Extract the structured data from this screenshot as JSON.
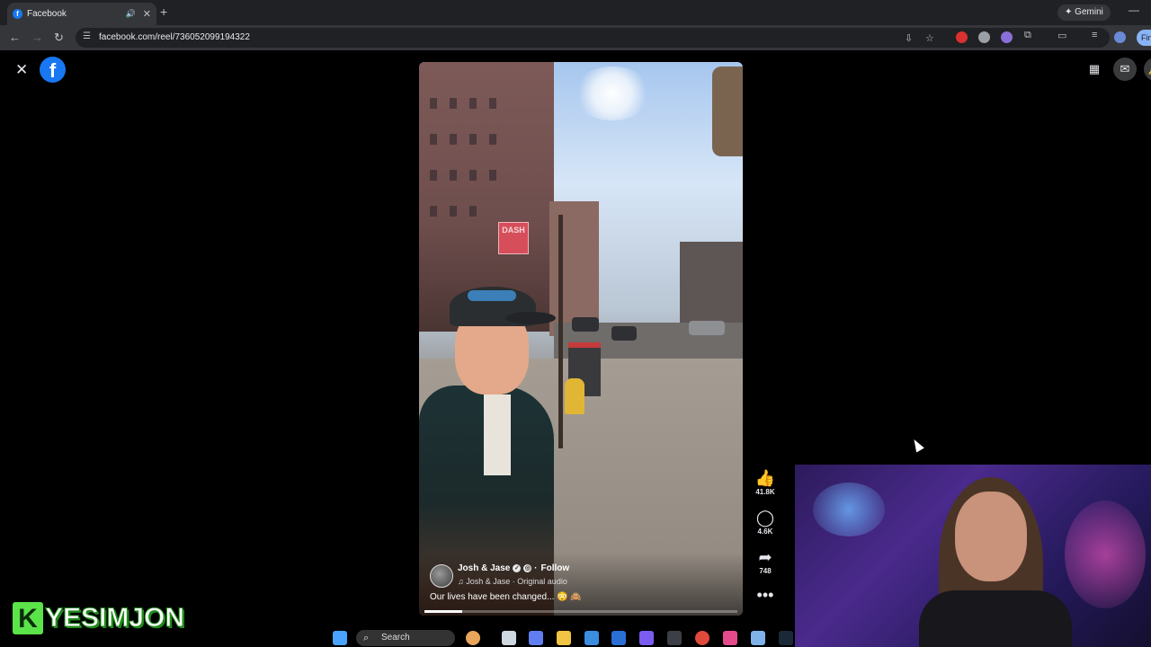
{
  "browser": {
    "tab_title": "Facebook",
    "new_tab_label": "+",
    "gemini_label": "Gemini",
    "url": "facebook.com/reel/736052099194322",
    "profile_label": "Fin"
  },
  "reel": {
    "author": "Josh & Jase",
    "follow_label": "Follow",
    "audio": "Josh & Jase · Original audio",
    "caption": "Our lives have been changed... 😳 🙈",
    "likes": "41.8K",
    "comments": "4.6K",
    "shares": "748",
    "progress": 0.12,
    "sign_text": "DASH"
  },
  "overlay": {
    "brand_letter": "K",
    "brand_name": "YESIMJON"
  },
  "taskbar": {
    "search_label": "Search"
  },
  "icons": {
    "close": "close-icon",
    "facebook": "facebook-logo",
    "apps": "apps-grid-icon",
    "messenger": "messenger-icon",
    "like": "thumbs-up-icon",
    "comment": "comment-icon",
    "share": "share-icon",
    "more": "more-icon"
  },
  "colors": {
    "facebook_blue": "#1877f2",
    "brand_green": "#5be34a"
  }
}
